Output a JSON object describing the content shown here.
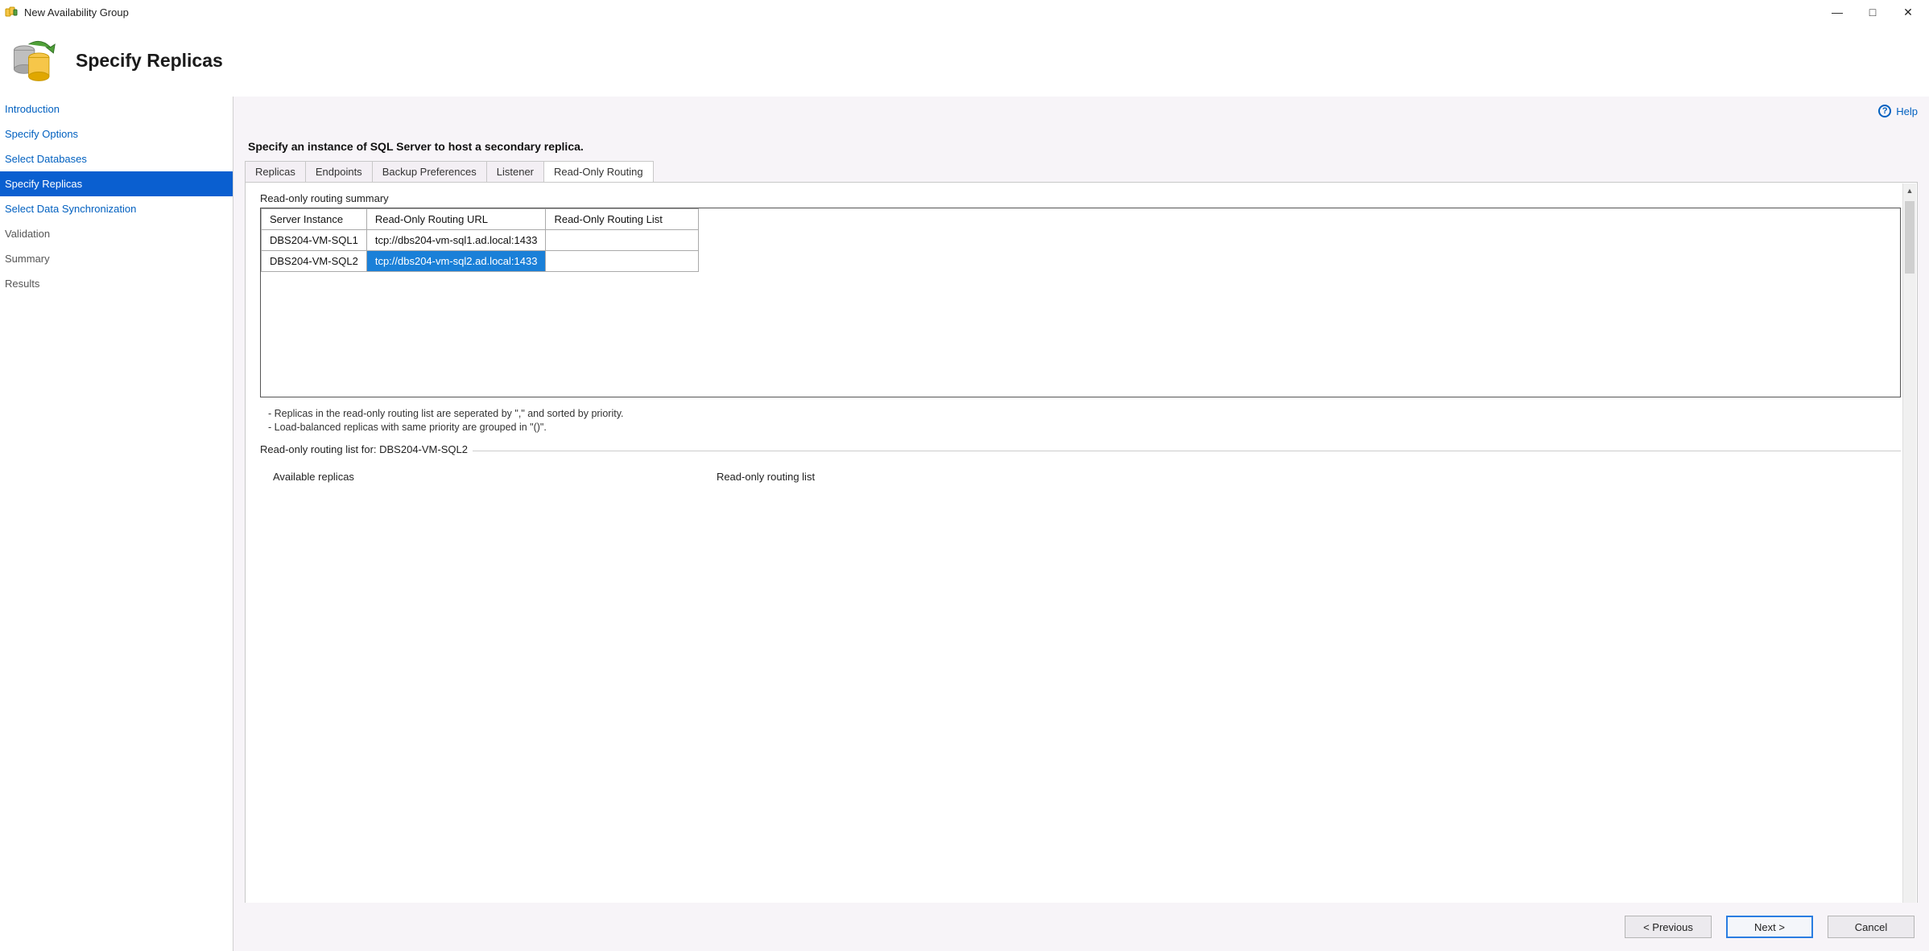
{
  "window": {
    "title": "New Availability Group"
  },
  "page": {
    "title": "Specify Replicas"
  },
  "nav": {
    "items": [
      {
        "label": "Introduction"
      },
      {
        "label": "Specify Options"
      },
      {
        "label": "Select Databases"
      },
      {
        "label": "Specify Replicas"
      },
      {
        "label": "Select Data Synchronization"
      },
      {
        "label": "Validation"
      },
      {
        "label": "Summary"
      },
      {
        "label": "Results"
      }
    ]
  },
  "help": {
    "label": "Help"
  },
  "instruction": "Specify an instance of SQL Server to host a secondary replica.",
  "tabs": [
    {
      "label": "Replicas"
    },
    {
      "label": "Endpoints"
    },
    {
      "label": "Backup Preferences"
    },
    {
      "label": "Listener"
    },
    {
      "label": "Read-Only Routing"
    }
  ],
  "summary": {
    "title": "Read-only routing summary",
    "cols": {
      "c0": "Server Instance",
      "c1": "Read-Only Routing URL",
      "c2": "Read-Only Routing List"
    },
    "rows": [
      {
        "server": "DBS204-VM-SQL1",
        "url": "tcp://dbs204-vm-sql1.ad.local:1433",
        "list": ""
      },
      {
        "server": "DBS204-VM-SQL2",
        "url": "tcp://dbs204-vm-sql2.ad.local:1433",
        "list": ""
      }
    ]
  },
  "hints": {
    "l1": "- Replicas in the read-only routing list are seperated by \",\" and sorted by priority.",
    "l2": "- Load-balanced replicas with same priority are grouped in \"()\"."
  },
  "routing": {
    "title": "Read-only routing list for: DBS204-VM-SQL2",
    "avail": "Available replicas",
    "list": "Read-only routing list"
  },
  "footer": {
    "prev": "< Previous",
    "next": "Next >",
    "cancel": "Cancel"
  }
}
